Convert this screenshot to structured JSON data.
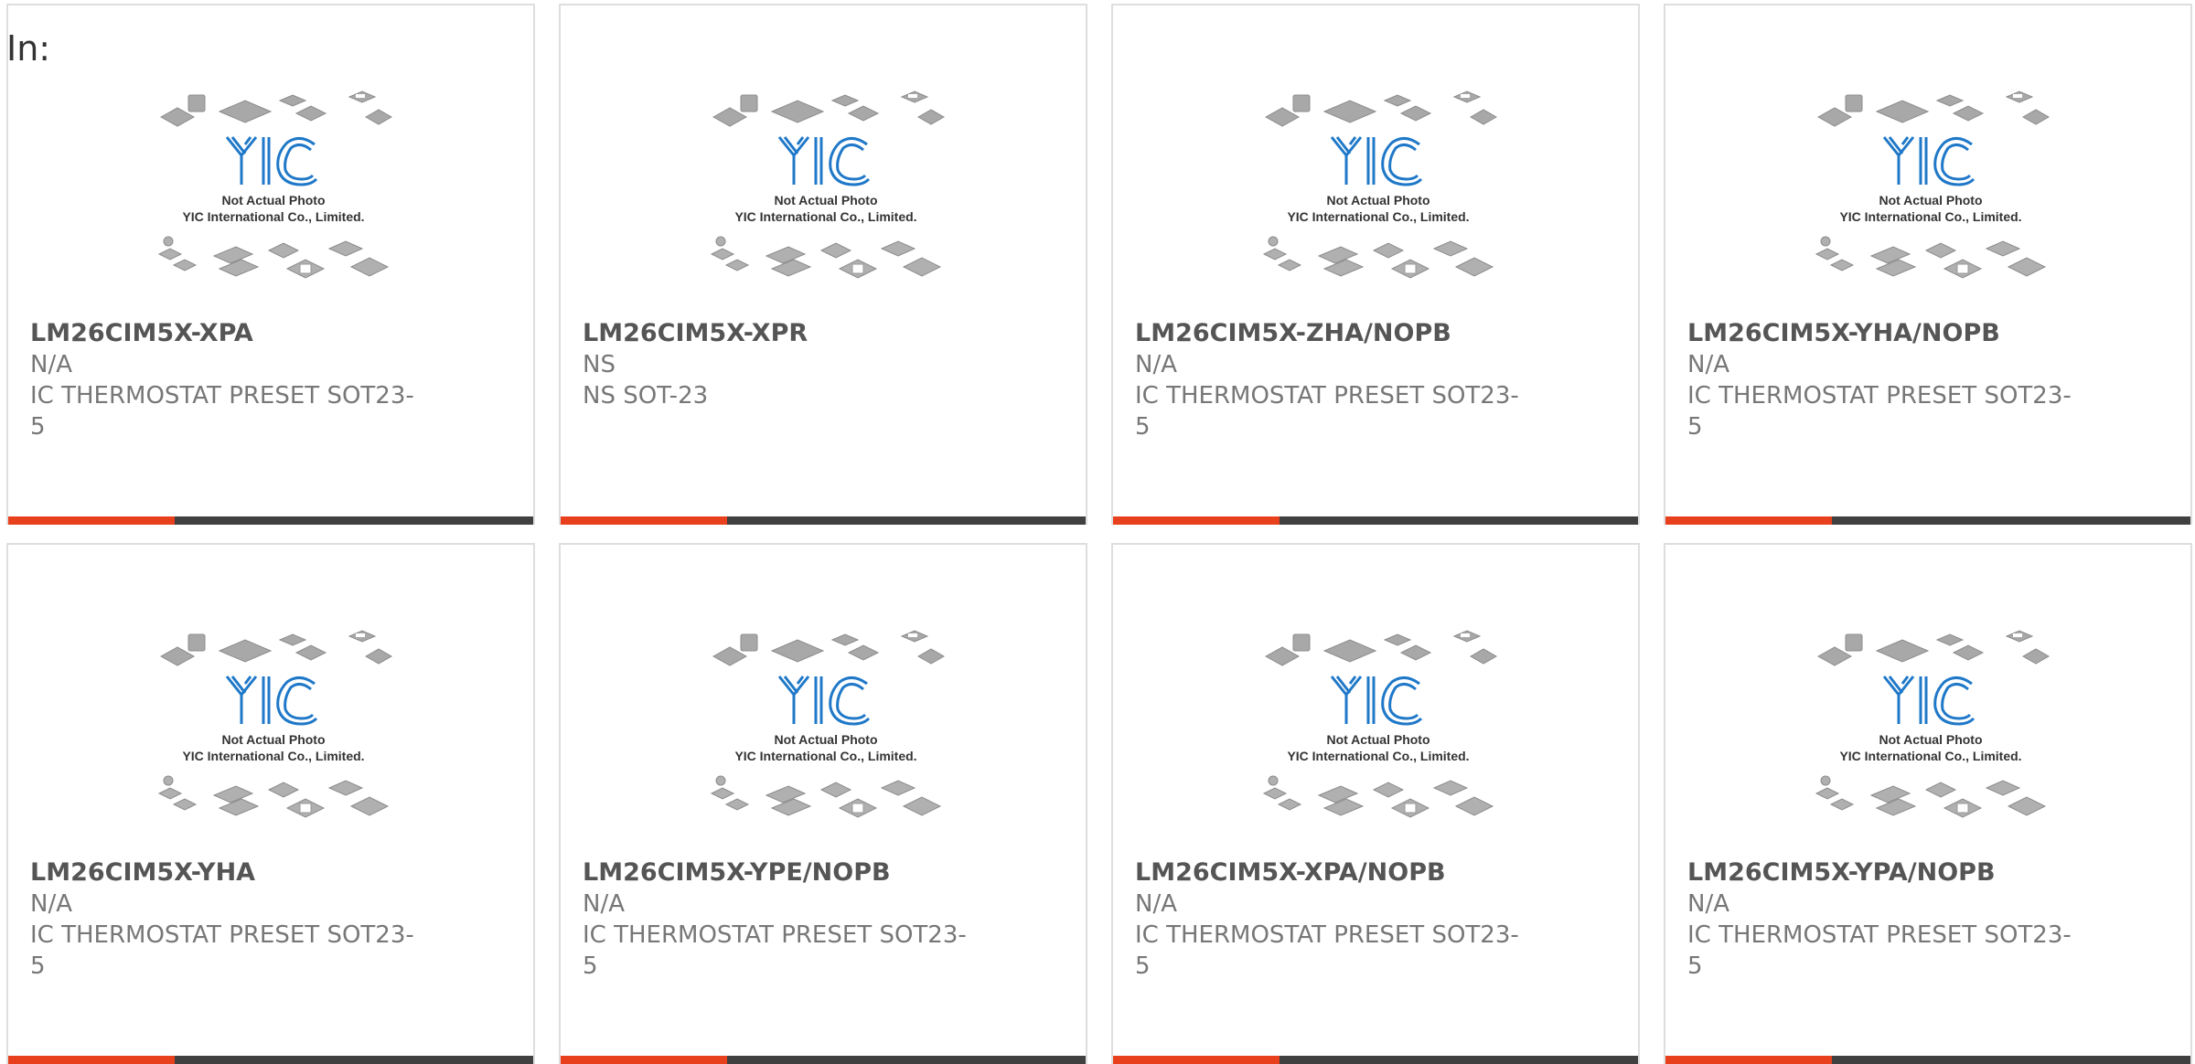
{
  "header": {
    "label": "In:"
  },
  "photo": {
    "line1": "Not Actual Photo",
    "line2": "YIC International Co., Limited.",
    "logo": "YIC"
  },
  "colors": {
    "accent": "#e8401c",
    "bar": "#404040",
    "logo_blue": "#1f78c8",
    "chip_gray": "#a8a8a8"
  },
  "products": [
    {
      "part": "LM26CIM5X-XPA",
      "mfr": "N/A",
      "desc": "IC THERMOSTAT PRESET SOT23-5"
    },
    {
      "part": "LM26CIM5X-XPR",
      "mfr": "NS",
      "desc": "NS SOT-23"
    },
    {
      "part": "LM26CIM5X-ZHA/NOPB",
      "mfr": "N/A",
      "desc": "IC THERMOSTAT PRESET SOT23-5"
    },
    {
      "part": "LM26CIM5X-YHA/NOPB",
      "mfr": "N/A",
      "desc": "IC THERMOSTAT PRESET SOT23-5"
    },
    {
      "part": "LM26CIM5X-YHA",
      "mfr": "N/A",
      "desc": "IC THERMOSTAT PRESET SOT23-5"
    },
    {
      "part": "LM26CIM5X-YPE/NOPB",
      "mfr": "N/A",
      "desc": "IC THERMOSTAT PRESET SOT23-5"
    },
    {
      "part": "LM26CIM5X-XPA/NOPB",
      "mfr": "N/A",
      "desc": "IC THERMOSTAT PRESET SOT23-5"
    },
    {
      "part": "LM26CIM5X-YPA/NOPB",
      "mfr": "N/A",
      "desc": "IC THERMOSTAT PRESET SOT23-5"
    }
  ]
}
